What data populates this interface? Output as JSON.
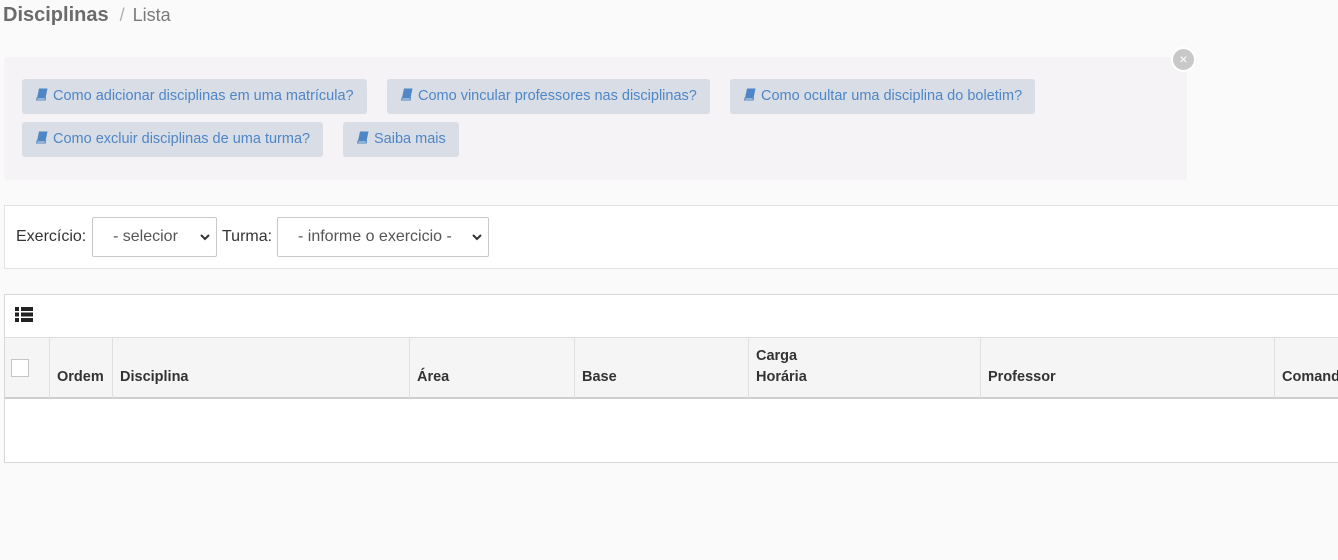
{
  "breadcrumb": {
    "title": "Disciplinas",
    "separator": "/",
    "current": "Lista"
  },
  "help_panel": {
    "close_label": "×",
    "buttons": [
      {
        "icon": "book-icon",
        "label": "Como adicionar disciplinas em uma matrícula?"
      },
      {
        "icon": "book-icon",
        "label": "Como vincular professores nas disciplinas?"
      },
      {
        "icon": "book-icon",
        "label": "Como ocultar uma disciplina do boletim?"
      },
      {
        "icon": "book-icon",
        "label": "Como excluir disciplinas de uma turma?"
      },
      {
        "icon": "book-icon",
        "label": "Saiba mais"
      }
    ]
  },
  "filters": {
    "exercicio_label": "Exercício:",
    "exercicio_value": "- selecior",
    "turma_label": "Turma:",
    "turma_value": "- informe o exercicio -"
  },
  "table": {
    "toolbar_icon": "list-icon",
    "columns": [
      {
        "label": ""
      },
      {
        "label": "Ordem"
      },
      {
        "label": "Disciplina"
      },
      {
        "label": "Área"
      },
      {
        "label": "Base"
      },
      {
        "label": "Carga",
        "label2": "Horária"
      },
      {
        "label": "Professor"
      },
      {
        "label": "Comandos"
      }
    ],
    "rows": []
  },
  "colors": {
    "help_button_bg": "#d8dde6",
    "help_button_text": "#4f86c6",
    "panel_bg": "#f5f3f5"
  }
}
